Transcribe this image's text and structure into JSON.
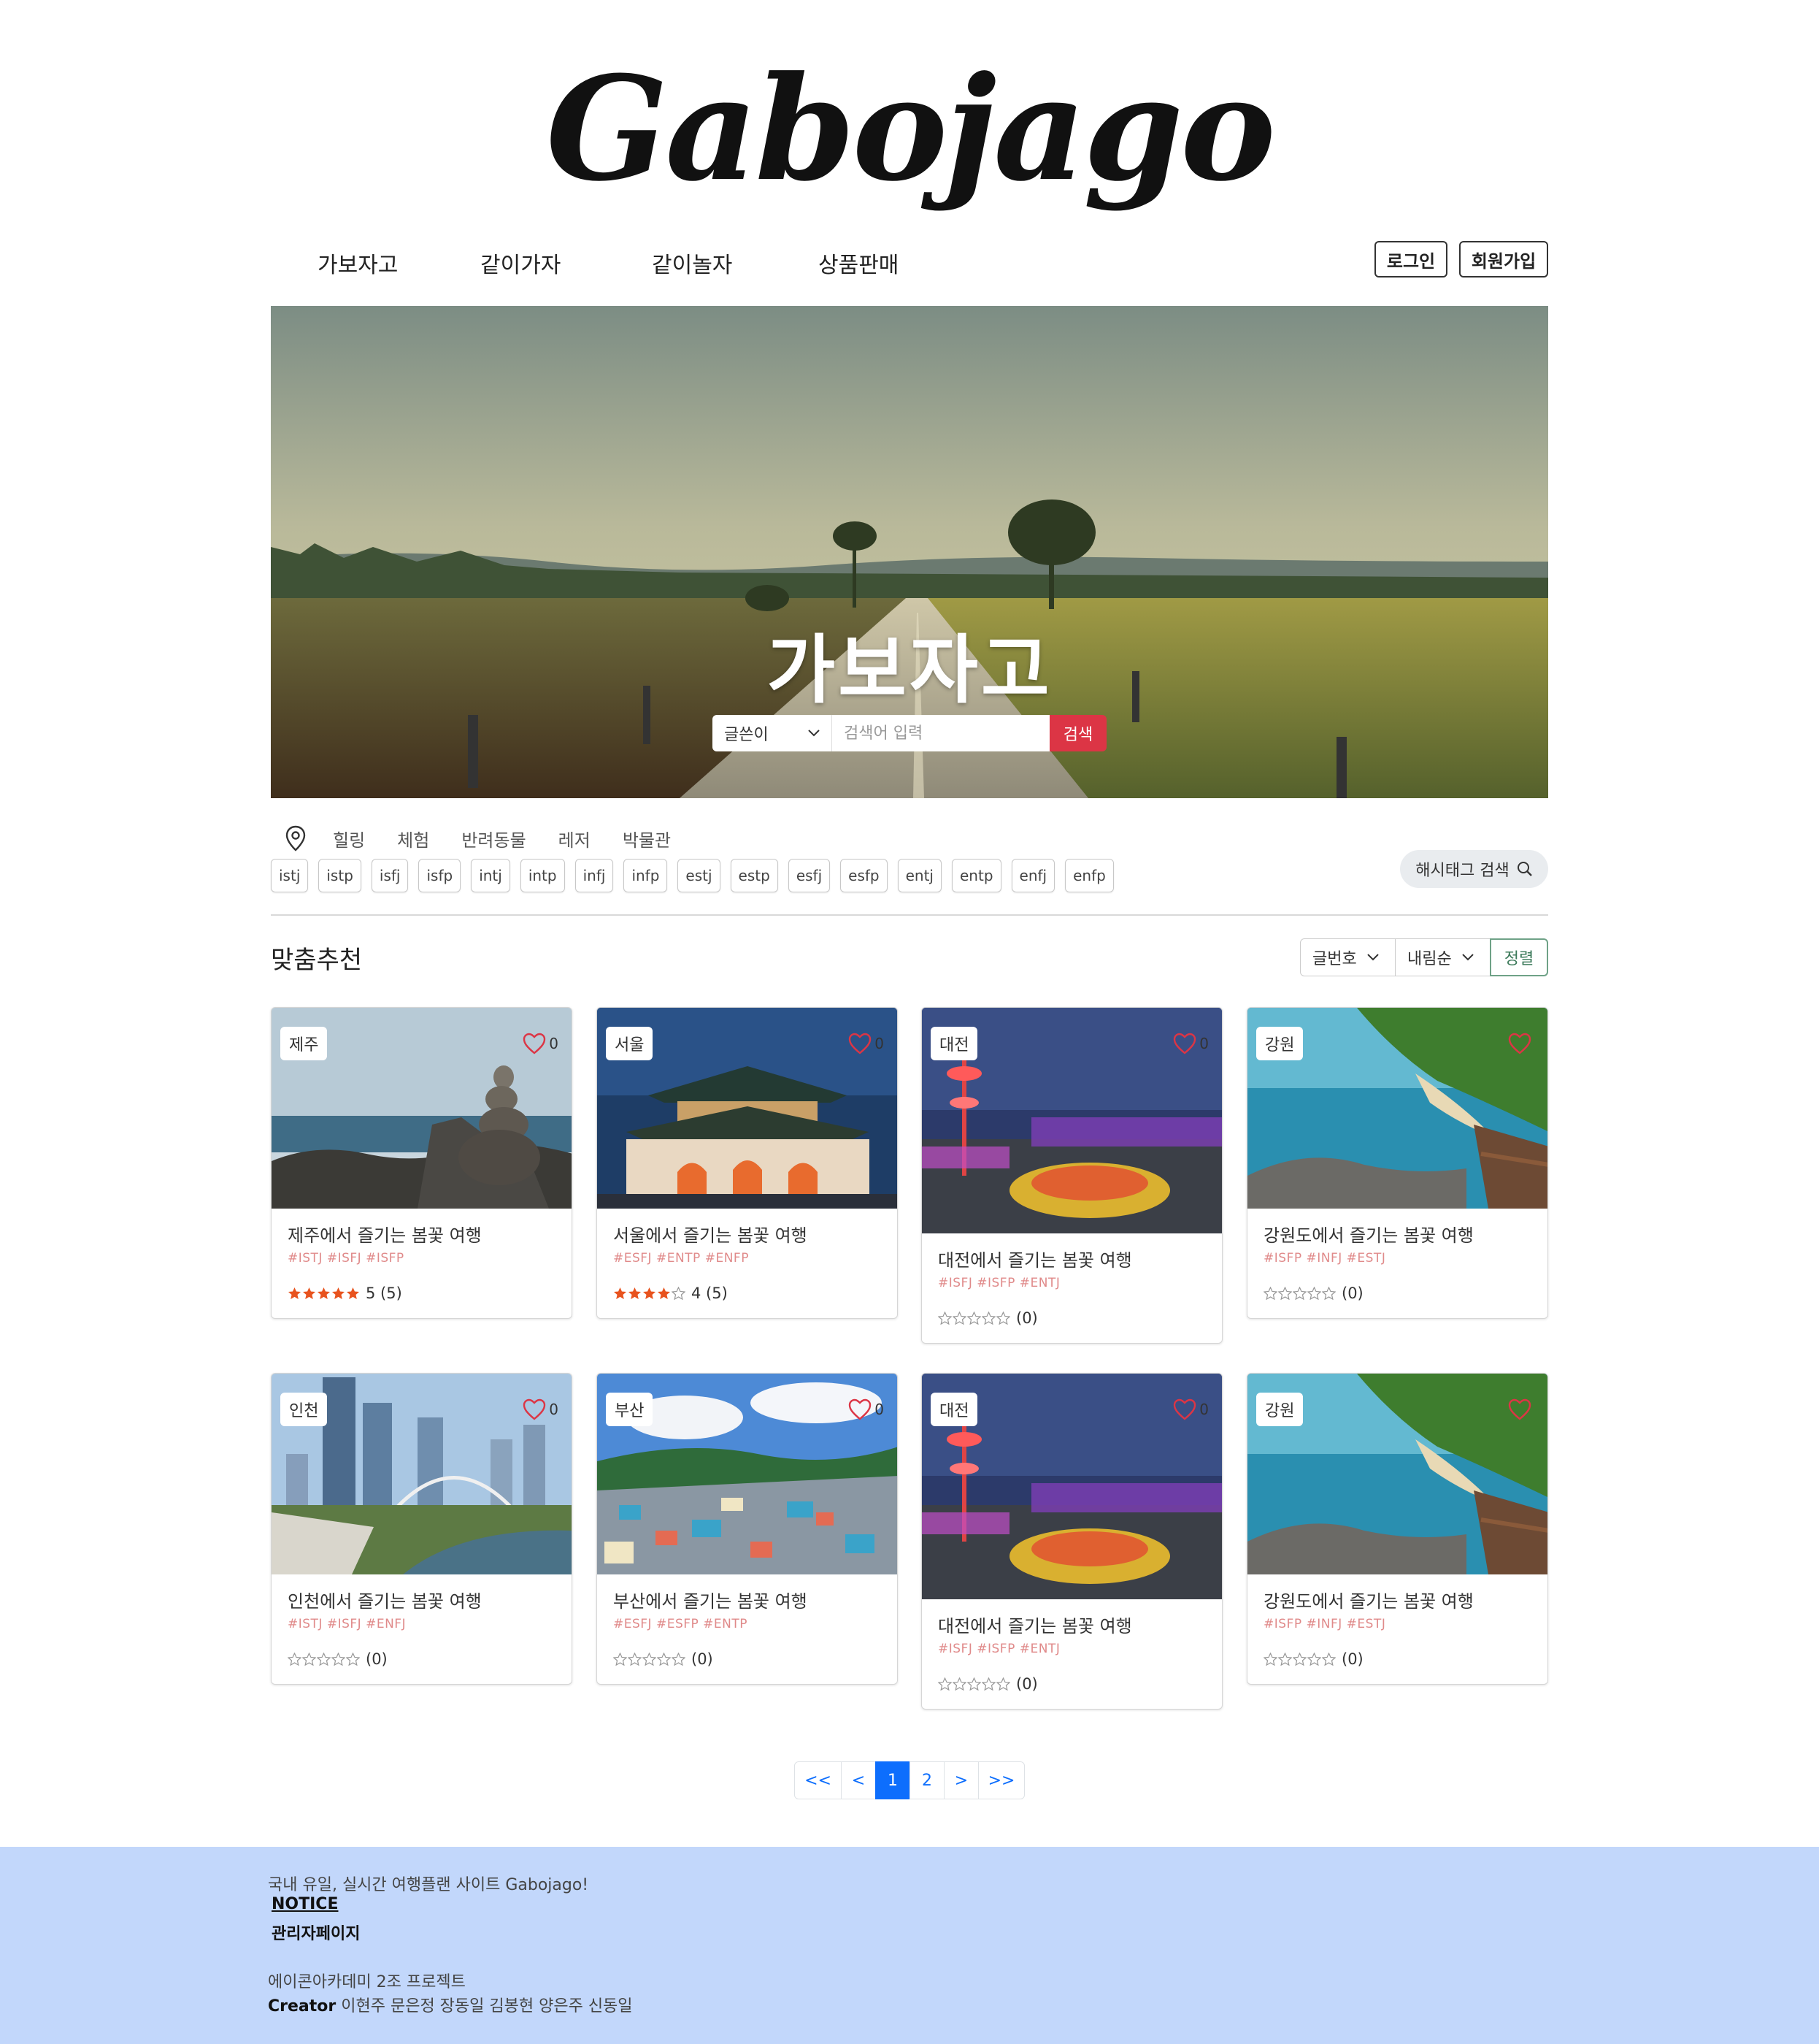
{
  "logo": "Gabojago",
  "nav": {
    "items": [
      "가보자고",
      "같이가자",
      "같이놀자",
      "상품판매"
    ],
    "login": "로그인",
    "signup": "회원가입"
  },
  "hero": {
    "title": "가보자고",
    "search": {
      "select_value": "글쓴이",
      "placeholder": "검색어 입력",
      "button": "검색"
    }
  },
  "categories": [
    "힐링",
    "체험",
    "반려동물",
    "레저",
    "박물관"
  ],
  "mbti_tags": [
    "istj",
    "istp",
    "isfj",
    "isfp",
    "intj",
    "intp",
    "infj",
    "infp",
    "estj",
    "estp",
    "esfj",
    "esfp",
    "entj",
    "entp",
    "enfj",
    "enfp"
  ],
  "hashtag_search": "해시태그 검색",
  "section": {
    "title": "맞춤추천",
    "sort_field": "글번호",
    "sort_order": "내림순",
    "sort_button": "정렬"
  },
  "cards": [
    {
      "region": "제주",
      "likes": "0",
      "title": "제주에서 즐기는 봄꽃 여행",
      "tags": "#ISTJ  #ISFJ  #ISFP",
      "stars": 5,
      "rating_text": "5 (5)",
      "image": "jeju-stone-tower"
    },
    {
      "region": "서울",
      "likes": "0",
      "title": "서울에서 즐기는 봄꽃 여행",
      "tags": "#ESFJ  #ENTP  #ENFP",
      "stars": 4,
      "rating_text": "4 (5)",
      "image": "gwanghwamun-gate"
    },
    {
      "region": "대전",
      "likes": "0",
      "title": "대전에서 즐기는 봄꽃 여행",
      "tags": "#ISFJ  #ISFP  #ENTJ",
      "stars": 0,
      "rating_text": "(0)",
      "image": "daejeon-night-park"
    },
    {
      "region": "강원",
      "likes": "",
      "title": "강원도에서 즐기는 봄꽃 여행",
      "tags": "#ISFP  #INFJ  #ESTJ",
      "stars": 0,
      "rating_text": "(0)",
      "image": "gangwon-coast"
    },
    {
      "region": "인천",
      "likes": "0",
      "title": "인천에서 즐기는 봄꽃 여행",
      "tags": "#ISTJ  #ISFJ  #ENFJ",
      "stars": 0,
      "rating_text": "(0)",
      "image": "incheon-skyline"
    },
    {
      "region": "부산",
      "likes": "0",
      "title": "부산에서 즐기는 봄꽃 여행",
      "tags": "#ESFJ  #ESFP  #ENTP",
      "stars": 0,
      "rating_text": "(0)",
      "image": "busan-village"
    },
    {
      "region": "대전",
      "likes": "0",
      "title": "대전에서 즐기는 봄꽃 여행",
      "tags": "#ISFJ  #ISFP  #ENTJ",
      "stars": 0,
      "rating_text": "(0)",
      "image": "daejeon-night-park"
    },
    {
      "region": "강원",
      "likes": "",
      "title": "강원도에서 즐기는 봄꽃 여행",
      "tags": "#ISFP  #INFJ  #ESTJ",
      "stars": 0,
      "rating_text": "(0)",
      "image": "gangwon-coast"
    }
  ],
  "pagination": {
    "first": "<<",
    "prev": "<",
    "pages": [
      "1",
      "2"
    ],
    "current": "1",
    "next": ">",
    "last": ">>"
  },
  "footer": {
    "tagline": "국내 유일, 실시간 여행플랜 사이트 Gabojago!",
    "notice": "NOTICE",
    "admin": "관리자페이지",
    "project": "에이콘아카데미 2조 프로젝트",
    "creator_label": "Creator",
    "creators": "이현주 문은정 장동일 김봉현 양은주 신동일"
  },
  "colors": {
    "search_button": "#dc3545",
    "page_active": "#0d6efd",
    "footer_bg": "#c2d7fb",
    "star": "#e8531e",
    "heart": "#dc3545"
  }
}
